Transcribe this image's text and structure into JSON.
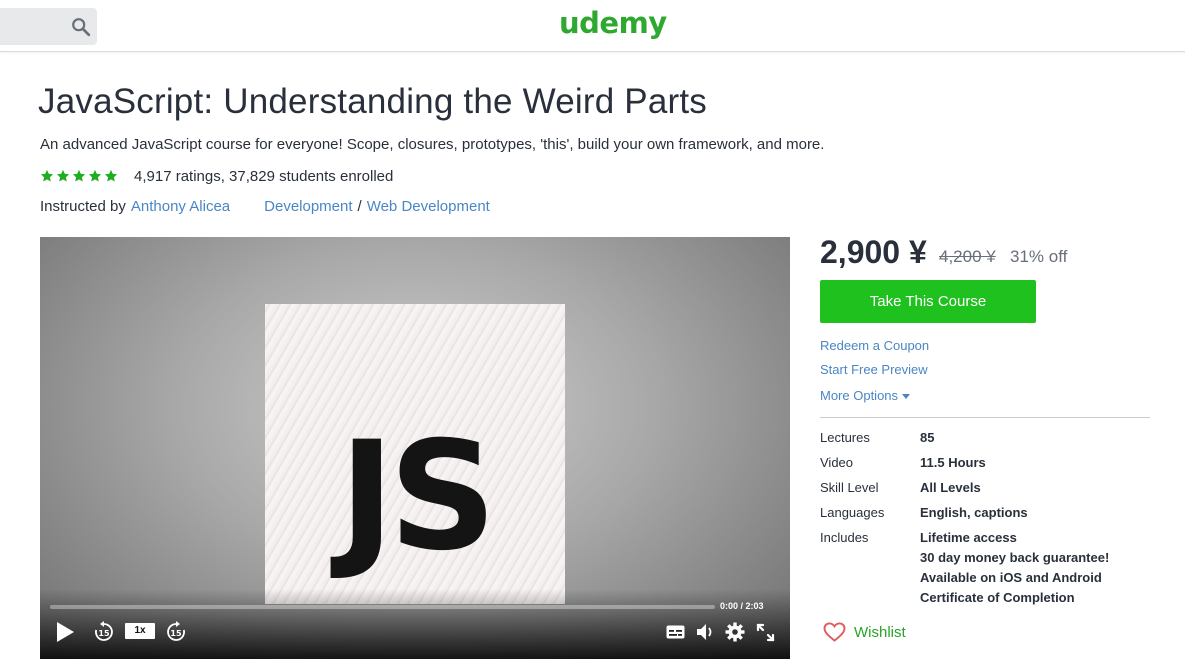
{
  "header": {
    "logo": "udemy",
    "search_icon": "search-icon"
  },
  "course": {
    "title": "JavaScript: Understanding the Weird Parts",
    "subtitle": "An advanced JavaScript course for everyone! Scope, closures, prototypes, 'this', build your own framework, and more.",
    "rating_stars": 5,
    "ratings_text": "4,917 ratings, 37,829 students enrolled",
    "instructed_by_label": "Instructed by",
    "instructor": "Anthony Alicea",
    "category": "Development",
    "category_separator": "/",
    "subcategory": "Web Development"
  },
  "video": {
    "poster_text": "JS",
    "speed": "1x",
    "time": "0:00  /  2:03",
    "progress": 0,
    "icons": [
      "play-icon",
      "rewind-15-icon",
      "forward-15-icon",
      "captions-icon",
      "volume-icon",
      "settings-icon",
      "fullscreen-icon"
    ]
  },
  "purchase": {
    "price": "2,900 ¥",
    "original_price": "4,200 ¥",
    "discount": "31% off",
    "cta_label": "Take This Course",
    "redeem_coupon": "Redeem a Coupon",
    "free_preview": "Start Free Preview",
    "more_options": "More Options"
  },
  "specs": [
    {
      "label": "Lectures",
      "value": "85"
    },
    {
      "label": "Video",
      "value": "11.5 Hours"
    },
    {
      "label": "Skill Level",
      "value": "All Levels"
    },
    {
      "label": "Languages",
      "value": "English, captions"
    },
    {
      "label": "Includes",
      "value": "Lifetime access"
    }
  ],
  "includes_extra": [
    "30 day money back guarantee!",
    "Available on iOS and Android",
    "Certificate of Completion"
  ],
  "wishlist_label": "Wishlist",
  "colors": {
    "brand_green": "#2fa82f",
    "cta_green": "#1ec11e",
    "link_blue": "#4a86c5",
    "star_green": "#1fae1f",
    "wishlist_heart": "#e05b5b"
  }
}
